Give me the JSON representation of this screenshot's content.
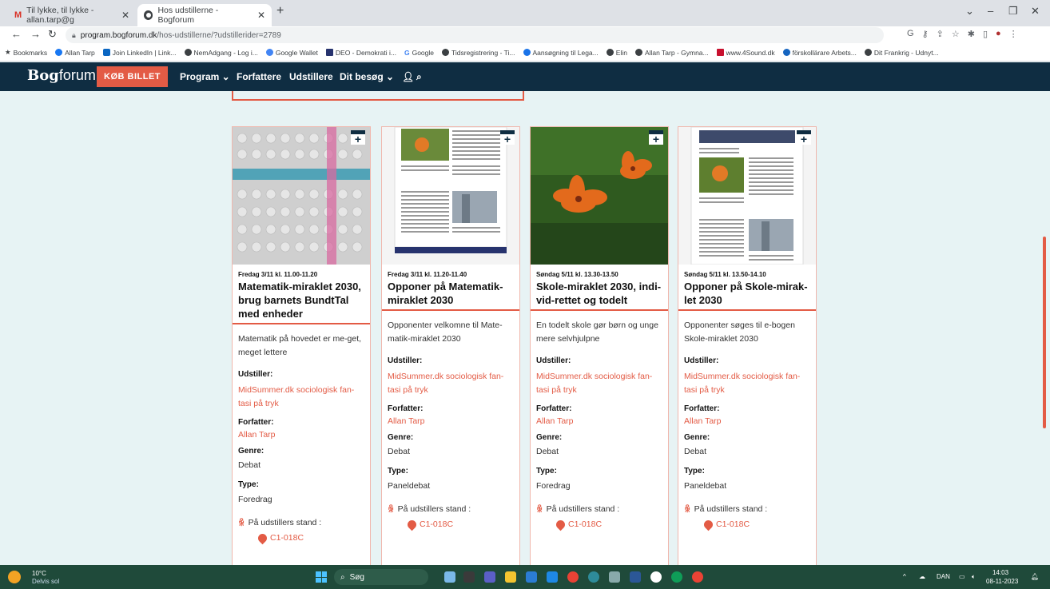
{
  "browser": {
    "tabs": [
      {
        "label": "Til lykke, til lykke - allan.tarp@g",
        "icon": "gmail-icon"
      },
      {
        "label": "Hos udstillerne - Bogforum",
        "icon": "globe-icon"
      }
    ],
    "address": {
      "host": "program.bogforum.dk",
      "path": "/hos-udstillerne/?udstillerider=2789"
    },
    "bookmarks": [
      "Bookmarks",
      "Allan Tarp",
      "Join LinkedIn | Link...",
      "NemAdgang - Log i...",
      "Google Wallet",
      "DEO - Demokrati i...",
      "Google",
      "Tidsregistrering - Ti...",
      "Aansøgning til Lega...",
      "Elin",
      "Allan Tarp - Gymna...",
      "www.4Sound.dk",
      "förskollärare Arbets...",
      "Dit Frankrig - Udnyt..."
    ],
    "colors": {
      "accent": "#e35b45",
      "header": "#0f2d42",
      "background": "#e7f3f4"
    }
  },
  "site": {
    "logo_bold": "Bog",
    "logo_light": "forum",
    "buy_label": "KØB BILLET",
    "menu": [
      "Program ⌄",
      "Forfattere",
      "Udstillere",
      "Dit besøg ⌄"
    ]
  },
  "labels": {
    "exhibitor": "Udstiller:",
    "author": "Forfatter:",
    "genre": "Genre:",
    "type": "Type:",
    "stand": "På udstillers stand :"
  },
  "cards": [
    {
      "time": "Fredag 3/11 kl. 11.00-11.20",
      "title": "Matematik-miraklet 2030, brug barnets BundtTal med enheder",
      "desc": "Matematik på hovedet er me-get, meget lettere",
      "exhibitor": "MidSummer.dk sociologisk fan-tasi på tryk",
      "author": "Allan Tarp",
      "genre": "Debat",
      "type": "Foredrag",
      "stand": "C1-018C"
    },
    {
      "time": "Fredag 3/11 kl. 11.20-11.40",
      "title": "Opponer på Matematik-miraklet 2030",
      "desc": "Opponenter velkomne til Mate-matik-miraklet 2030",
      "exhibitor": "MidSummer.dk sociologisk fan-tasi på tryk",
      "author": "Allan Tarp",
      "genre": "Debat",
      "type": "Paneldebat",
      "stand": "C1-018C"
    },
    {
      "time": "Søndag 5/11 kl. 13.30-13.50",
      "title": "Skole-miraklet 2030, indi-vid-rettet og todelt",
      "desc": "En todelt skole gør børn og unge mere selvhjulpne",
      "exhibitor": "MidSummer.dk sociologisk fan-tasi på tryk",
      "author": "Allan Tarp",
      "genre": "Debat",
      "type": "Foredrag",
      "stand": "C1-018C"
    },
    {
      "time": "Søndag 5/11 kl. 13.50-14.10",
      "title": "Opponer på Skole-mirak-let 2030",
      "desc": "Opponenter søges til e-bogen Skole-miraklet 2030",
      "exhibitor": "MidSummer.dk sociologisk fan-tasi på tryk",
      "author": "Allan Tarp",
      "genre": "Debat",
      "type": "Paneldebat",
      "stand": "C1-018C"
    }
  ],
  "taskbar": {
    "weather_temp": "10°C",
    "weather_desc": "Delvis sol",
    "search_label": "Søg",
    "lang": "DAN",
    "time": "14:03",
    "date": "08-11-2023"
  }
}
